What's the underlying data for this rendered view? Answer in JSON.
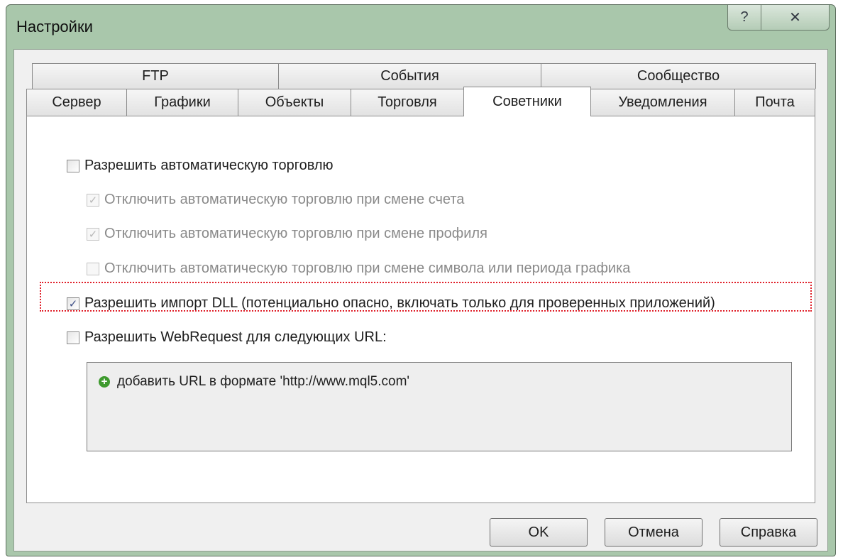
{
  "window": {
    "title": "Настройки",
    "help_label": "?",
    "close_label": "✕"
  },
  "tabs_top": [
    {
      "label": "FTP"
    },
    {
      "label": "События"
    },
    {
      "label": "Сообщество"
    }
  ],
  "tabs_bottom": [
    {
      "label": "Сервер"
    },
    {
      "label": "Графики"
    },
    {
      "label": "Объекты"
    },
    {
      "label": "Торговля"
    },
    {
      "label": "Советники",
      "active": true
    },
    {
      "label": "Уведомления"
    },
    {
      "label": "Почта"
    }
  ],
  "options": {
    "allow_auto_trading": {
      "label": "Разрешить автоматическую торговлю",
      "checked": false,
      "enabled": true
    },
    "disable_on_account": {
      "label": "Отключить автоматическую торговлю при смене счета",
      "checked": true,
      "enabled": false
    },
    "disable_on_profile": {
      "label": "Отключить автоматическую торговлю при смене профиля",
      "checked": true,
      "enabled": false
    },
    "disable_on_symbol": {
      "label": "Отключить автоматическую торговлю при смене символа или периода графика",
      "checked": false,
      "enabled": false
    },
    "allow_dll": {
      "label": "Разрешить импорт DLL (потенциально опасно, включать только для проверенных приложений)",
      "checked": true,
      "enabled": true
    },
    "allow_webrequest": {
      "label": "Разрешить WebRequest для следующих URL:",
      "checked": false,
      "enabled": true
    }
  },
  "url_list": {
    "add_label": "добавить URL в формате 'http://www.mql5.com'"
  },
  "buttons": {
    "ok": "OK",
    "cancel": "Отмена",
    "help": "Справка"
  },
  "colors": {
    "frame": "#a9c7ab",
    "focus_outline": "#e0202a",
    "check": "#3d4e86"
  },
  "icons": {
    "add": "plus-circle-icon",
    "check": "checkmark-icon"
  }
}
